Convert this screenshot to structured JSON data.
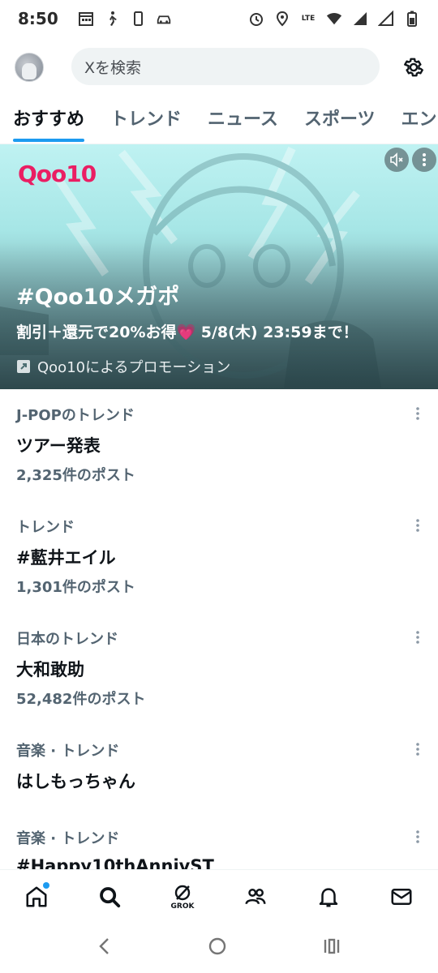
{
  "status": {
    "time": "8:50",
    "network": "LTE"
  },
  "header": {
    "search_placeholder": "Xを検索"
  },
  "tabs": [
    {
      "label": "おすすめ"
    },
    {
      "label": "トレンド"
    },
    {
      "label": "ニュース"
    },
    {
      "label": "スポーツ"
    },
    {
      "label": "エン"
    }
  ],
  "promo": {
    "brand": "Qoo10",
    "title": "#Qoo10メガポ",
    "subtitle": "割引＋還元で20%お得💗 5/8(木) 23:59まで！",
    "promoted_by": "Qoo10によるプロモーション",
    "brand_color": "#ea1e63"
  },
  "trends": [
    {
      "category": "J-POPのトレンド",
      "name": "ツアー発表",
      "count": "2,325件のポスト"
    },
    {
      "category": "トレンド",
      "name": "#藍井エイル",
      "count": "1,301件のポスト"
    },
    {
      "category": "日本のトレンド",
      "name": "大和敢助",
      "count": "52,482件のポスト"
    },
    {
      "category": "音楽 · トレンド",
      "name": "はしもっちゃん",
      "count": ""
    },
    {
      "category": "音楽 · トレンド",
      "name": "#Happy10thAnnivST",
      "count": ""
    }
  ],
  "bottom_nav": {
    "items": [
      "home-icon",
      "search-icon",
      "grok-icon",
      "communities-icon",
      "notifications-icon",
      "messages-icon"
    ],
    "grok_label": "GROK"
  },
  "colors": {
    "accent": "#1d9bf0",
    "text": "#0f1419",
    "secondary": "#536471"
  }
}
